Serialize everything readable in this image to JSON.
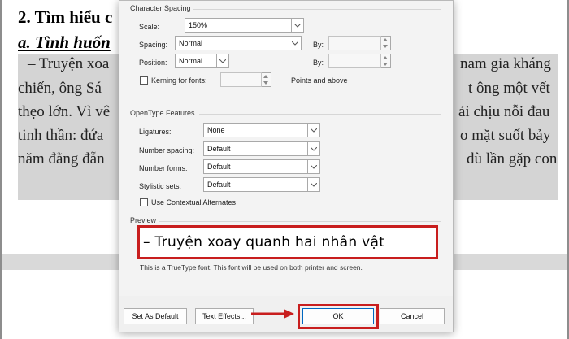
{
  "document": {
    "heading": "2. Tìm hiểu c",
    "subheading": "a. Tình huốn",
    "lines_left": [
      "– Truyện xoa",
      "chiến, ông Sá",
      "thẹo lớn. Vì vê",
      "tinh thần: đứa",
      "năm đằng đẵn"
    ],
    "lines_right": [
      "nam gia kháng",
      "t ông một vết",
      "ải chịu nỗi đau",
      "o mặt suốt bảy",
      "dù lần gặp con"
    ]
  },
  "dialog": {
    "character_spacing": {
      "group_title": "Character Spacing",
      "scale_label": "Scale:",
      "scale_value": "150%",
      "spacing_label": "Spacing:",
      "spacing_value": "Normal",
      "by_label": "By:",
      "position_label": "Position:",
      "position_value": "Normal",
      "by2_label": "By:",
      "kerning_label": "Kerning for fonts:",
      "points_label": "Points and above"
    },
    "opentype": {
      "group_title": "OpenType Features",
      "ligatures_label": "Ligatures:",
      "ligatures_value": "None",
      "number_spacing_label": "Number spacing:",
      "number_spacing_value": "Default",
      "number_forms_label": "Number forms:",
      "number_forms_value": "Default",
      "stylistic_sets_label": "Stylistic sets:",
      "stylistic_sets_value": "Default",
      "contextual_alternates_label": "Use Contextual Alternates"
    },
    "preview": {
      "group_title": "Preview",
      "sample_text": "– Truyện xoay quanh hai nhân vật",
      "note": "This is a TrueType font. This font will be used on both printer and screen."
    },
    "buttons": {
      "set_as_default": "Set As Default",
      "text_effects": "Text Effects...",
      "ok": "OK",
      "cancel": "Cancel"
    }
  },
  "colors": {
    "highlight": "#c81e1e",
    "selection": "#d4d4d4"
  },
  "icons": [
    "chevron-down-icon",
    "spin-up-icon",
    "spin-down-icon",
    "red-arrow-icon"
  ]
}
